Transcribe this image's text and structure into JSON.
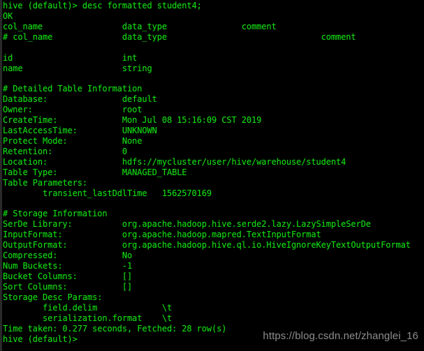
{
  "terminal": {
    "title": "Hive CLI",
    "prompt": "hive (default)>",
    "command": "desc formatted student4;",
    "colors": {
      "background": "#000000",
      "foreground": "#15dd15",
      "watermark": "#8d8d8d",
      "window_edge": "#2a2a2a"
    },
    "console_text": "hive (default)> desc formatted student4;\nOK\ncol_name             \tdata_type           \tcomment             \n# col_name            \tdata_type           \t\t\tcomment             \n\t\t \nid                  \tint                 \t                    \nname                \tstring              \t                    \n\t\t \n# Detailed Table Information\t\t \nDatabase:           \tdefault             \t \nOwner:              \troot                \t \nCreateTime:         \tMon Jul 08 15:16:09 CST 2019\t \nLastAccessTime:     \tUNKNOWN             \t \nProtect Mode:       \tNone                \t \nRetention:          \t0                   \t \nLocation:           \thdfs://mycluster/user/hive/warehouse/student4\t \nTable Type:         \tMANAGED_TABLE       \t \nTable Parameters:\t\t \n\ttransient_lastDdlTime\t1562570169          \n\t\t \n# Storage Information\t\t \nSerDe Library:      \torg.apache.hadoop.hive.serde2.lazy.LazySimpleSerDe\t \nInputFormat:        \torg.apache.hadoop.mapred.TextInputFormat\t \nOutputFormat:       \torg.apache.hadoop.hive.ql.io.HiveIgnoreKeyTextOutputFormat\t \nCompressed:         \tNo                  \t \nNum Buckets:        \t-1                  \t \nBucket Columns:     \t[]                  \t \nSort Columns:       \t[]                  \t \nStorage Desc Params:\t\t \n\tfield.delim         \t\\t                  \n\tserialization.format\t\\t                  \nTime taken: 0.277 seconds, Fetched: 28 row(s)\nhive (default)> ",
    "lines": [
      "hive (default)> desc formatted student4;",
      "OK",
      "col_name             data_type           comment",
      "# col_name                  data_type                       comment",
      "",
      "id                        int",
      "name                      string",
      "",
      "# Detailed Table Information",
      "Database:                 default",
      "Owner:                    root",
      "CreateTime:               Mon Jul 08 15:16:09 CST 2019",
      "LastAccessTime:           UNKNOWN",
      "Protect Mode:             None",
      "Retention:                0",
      "Location:                 hdfs://mycluster/user/hive/warehouse/student4",
      "Table Type:               MANAGED_TABLE",
      "Table Parameters:",
      "        transient_lastDdlTime   1562570169",
      "",
      "# Storage Information",
      "SerDe Library:            org.apache.hadoop.hive.serde2.lazy.LazySimpleSerDe",
      "InputFormat:              org.apache.hadoop.mapred.TextInputFormat",
      "OutputFormat:             org.apache.hadoop.hive.ql.io.HiveIgnoreKeyTextOutputFormat",
      "Compressed:               No",
      "Num Buckets:              -1",
      "Bucket Columns:           []",
      "Sort Columns:             []",
      "Storage Desc Params:",
      "        field.delim             \\t",
      "        serialization.format    \\t",
      "Time taken: 0.277 seconds, Fetched: 28 row(s)",
      "hive (default)> "
    ],
    "column_headers": {
      "col_name": "col_name",
      "data_type": "data_type",
      "comment": "comment"
    },
    "schema_columns": [
      {
        "col_name": "id",
        "data_type": "int",
        "comment": ""
      },
      {
        "col_name": "name",
        "data_type": "string",
        "comment": ""
      }
    ],
    "detailed_table_information": {
      "section_title": "# Detailed Table Information",
      "Database": "default",
      "Owner": "root",
      "CreateTime": "Mon Jul 08 15:16:09 CST 2019",
      "LastAccessTime": "UNKNOWN",
      "Protect Mode": "None",
      "Retention": "0",
      "Location": "hdfs://mycluster/user/hive/warehouse/student4",
      "Table Type": "MANAGED_TABLE",
      "Table Parameters": {
        "transient_lastDdlTime": "1562570169"
      }
    },
    "storage_information": {
      "section_title": "# Storage Information",
      "SerDe Library": "org.apache.hadoop.hive.serde2.lazy.LazySimpleSerDe",
      "InputFormat": "org.apache.hadoop.mapred.TextInputFormat",
      "OutputFormat": "org.apache.hadoop.hive.ql.io.HiveIgnoreKeyTextOutputFormat",
      "Compressed": "No",
      "Num Buckets": "-1",
      "Bucket Columns": "[]",
      "Sort Columns": "[]",
      "Storage Desc Params": {
        "field.delim": "\\t",
        "serialization.format": "\\t"
      }
    },
    "status_line": "Time taken: 0.277 seconds, Fetched: 28 row(s)",
    "time_taken_seconds": "0.277",
    "fetched_rows": "28"
  },
  "watermark": {
    "text": "https://blog.csdn.net/zhanglei_16"
  }
}
